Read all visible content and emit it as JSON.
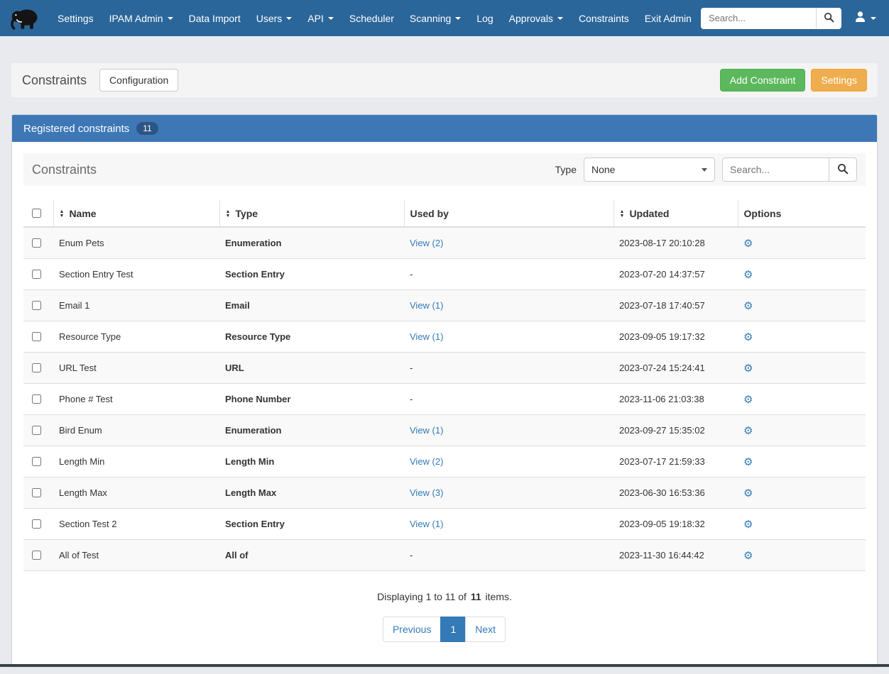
{
  "navbar": {
    "items": [
      {
        "label": "Settings",
        "dropdown": false
      },
      {
        "label": "IPAM Admin",
        "dropdown": true
      },
      {
        "label": "Data Import",
        "dropdown": false
      },
      {
        "label": "Users",
        "dropdown": true
      },
      {
        "label": "API",
        "dropdown": true
      },
      {
        "label": "Scheduler",
        "dropdown": false
      },
      {
        "label": "Scanning",
        "dropdown": true
      },
      {
        "label": "Log",
        "dropdown": false
      },
      {
        "label": "Approvals",
        "dropdown": true
      },
      {
        "label": "Constraints",
        "dropdown": false
      },
      {
        "label": "Exit Admin",
        "dropdown": false
      }
    ],
    "search_placeholder": "Search..."
  },
  "page_header": {
    "title": "Constraints",
    "configuration_button": "Configuration",
    "add_constraint_button": "Add Constraint",
    "settings_button": "Settings"
  },
  "panel": {
    "title": "Registered constraints",
    "badge": "11",
    "toolbar": {
      "heading": "Constraints",
      "type_label": "Type",
      "type_selected_value": "None",
      "search_placeholder": "Search..."
    },
    "table": {
      "headers": [
        {
          "label": "Name",
          "sortable": true
        },
        {
          "label": "Type",
          "sortable": true
        },
        {
          "label": "Used by",
          "sortable": false
        },
        {
          "label": "Updated",
          "sortable": true
        },
        {
          "label": "Options",
          "sortable": false
        }
      ],
      "rows": [
        {
          "name": "Enum Pets",
          "type": "Enumeration",
          "used_by": "View (2)",
          "used_by_is_link": true,
          "updated": "2023-08-17 20:10:28"
        },
        {
          "name": "Section Entry Test",
          "type": "Section Entry",
          "used_by": "-",
          "used_by_is_link": false,
          "updated": "2023-07-20 14:37:57"
        },
        {
          "name": "Email 1",
          "type": "Email",
          "used_by": "View (1)",
          "used_by_is_link": true,
          "updated": "2023-07-18 17:40:57"
        },
        {
          "name": "Resource Type",
          "type": "Resource Type",
          "used_by": "View (1)",
          "used_by_is_link": true,
          "updated": "2023-09-05 19:17:32"
        },
        {
          "name": "URL Test",
          "type": "URL",
          "used_by": "-",
          "used_by_is_link": false,
          "updated": "2023-07-24 15:24:41"
        },
        {
          "name": "Phone # Test",
          "type": "Phone Number",
          "used_by": "-",
          "used_by_is_link": false,
          "updated": "2023-11-06 21:03:38"
        },
        {
          "name": "Bird Enum",
          "type": "Enumeration",
          "used_by": "View (1)",
          "used_by_is_link": true,
          "updated": "2023-09-27 15:35:02"
        },
        {
          "name": "Length Min",
          "type": "Length Min",
          "used_by": "View (2)",
          "used_by_is_link": true,
          "updated": "2023-07-17 21:59:33"
        },
        {
          "name": "Length Max",
          "type": "Length Max",
          "used_by": "View (3)",
          "used_by_is_link": true,
          "updated": "2023-06-30 16:53:36"
        },
        {
          "name": "Section Test 2",
          "type": "Section Entry",
          "used_by": "View (1)",
          "used_by_is_link": true,
          "updated": "2023-09-05 19:18:32"
        },
        {
          "name": "All of Test",
          "type": "All of",
          "used_by": "-",
          "used_by_is_link": false,
          "updated": "2023-11-30 16:44:42"
        }
      ]
    },
    "summary": {
      "text_before": "Displaying 1 to 11 of",
      "total": "11",
      "text_after": "items."
    },
    "pagination": {
      "previous": "Previous",
      "page": "1",
      "next": "Next"
    }
  },
  "icons": {
    "gear": "⚙",
    "sort_up": "▲",
    "sort_down": "▼"
  },
  "colors": {
    "navbar": "#2b669a",
    "panel_header": "#3d77b6",
    "success_button": "#5cb85c",
    "warning_button": "#f0ad4e",
    "link": "#337ab7"
  }
}
